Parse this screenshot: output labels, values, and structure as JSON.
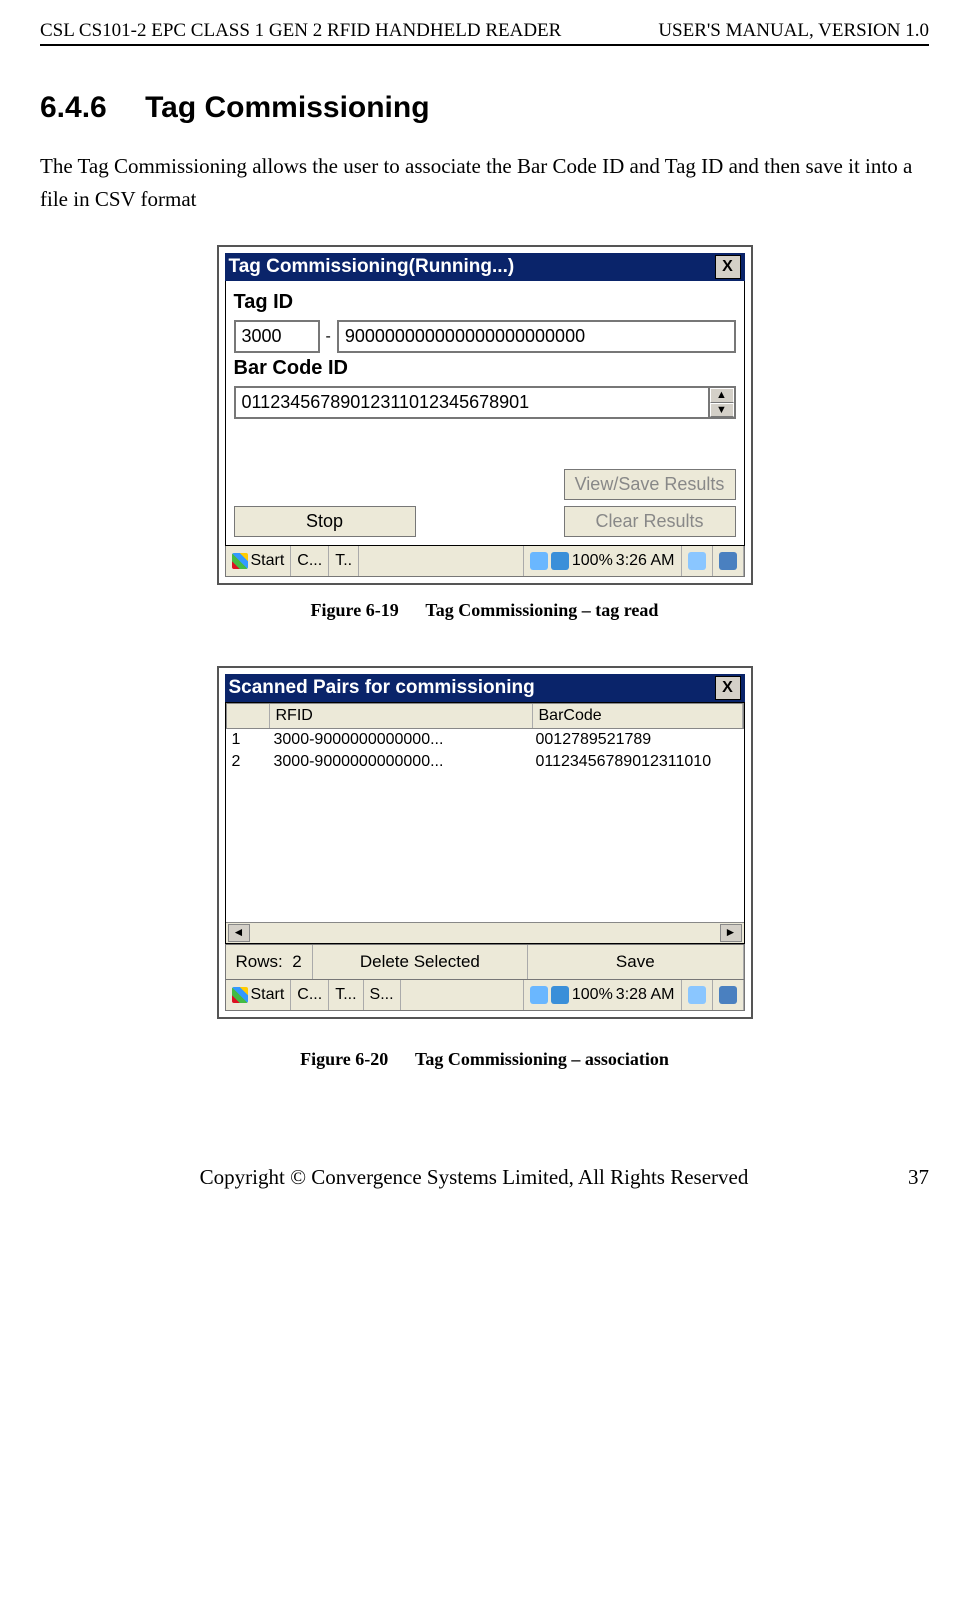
{
  "header": {
    "left": "CSL CS101-2 EPC CLASS 1 GEN 2 RFID HANDHELD READER",
    "right": "USER'S  MANUAL,  VERSION  1.0"
  },
  "section": {
    "number": "6.4.6",
    "title": "Tag Commissioning"
  },
  "paragraph": "The Tag Commissioning allows the user to associate the Bar Code ID and Tag ID and then save it into a file in CSV format",
  "fig1": {
    "title": "Tag Commissioning(Running...)",
    "close": "X",
    "tag_label": "Tag ID",
    "tag_prefix": "3000",
    "tag_dash": "-",
    "tag_value": "900000000000000000000000",
    "barcode_label": "Bar Code ID",
    "barcode_value": "01123456789012311012345678901",
    "btn_stop": "Stop",
    "btn_view": "View/Save Results",
    "btn_clear": "Clear Results",
    "taskbar": {
      "start": "Start",
      "t1": "C...",
      "t2": "T..",
      "battery": "100%",
      "time": "3:26 AM"
    },
    "caption_num": "Figure 6-19",
    "caption_text": "Tag Commissioning – tag read"
  },
  "fig2": {
    "title": "Scanned Pairs for commissioning",
    "close": "X",
    "col_blank": "",
    "col_rfid": "RFID",
    "col_barcode": "BarCode",
    "rows": [
      {
        "n": "1",
        "rfid": "3000-9000000000000...",
        "bc": "0012789521789"
      },
      {
        "n": "2",
        "rfid": "3000-9000000000000...",
        "bc": "01123456789012311010"
      }
    ],
    "rows_label": "Rows:",
    "rows_count": "2",
    "btn_delete": "Delete Selected",
    "btn_save": "Save",
    "taskbar": {
      "start": "Start",
      "t1": "C...",
      "t2": "T...",
      "t3": "S...",
      "battery": "100%",
      "time": "3:28 AM"
    },
    "caption_num": "Figure 6-20",
    "caption_text": "Tag Commissioning – association"
  },
  "footer": {
    "text": "Copyright © Convergence Systems Limited, All Rights Reserved",
    "page": "37"
  }
}
